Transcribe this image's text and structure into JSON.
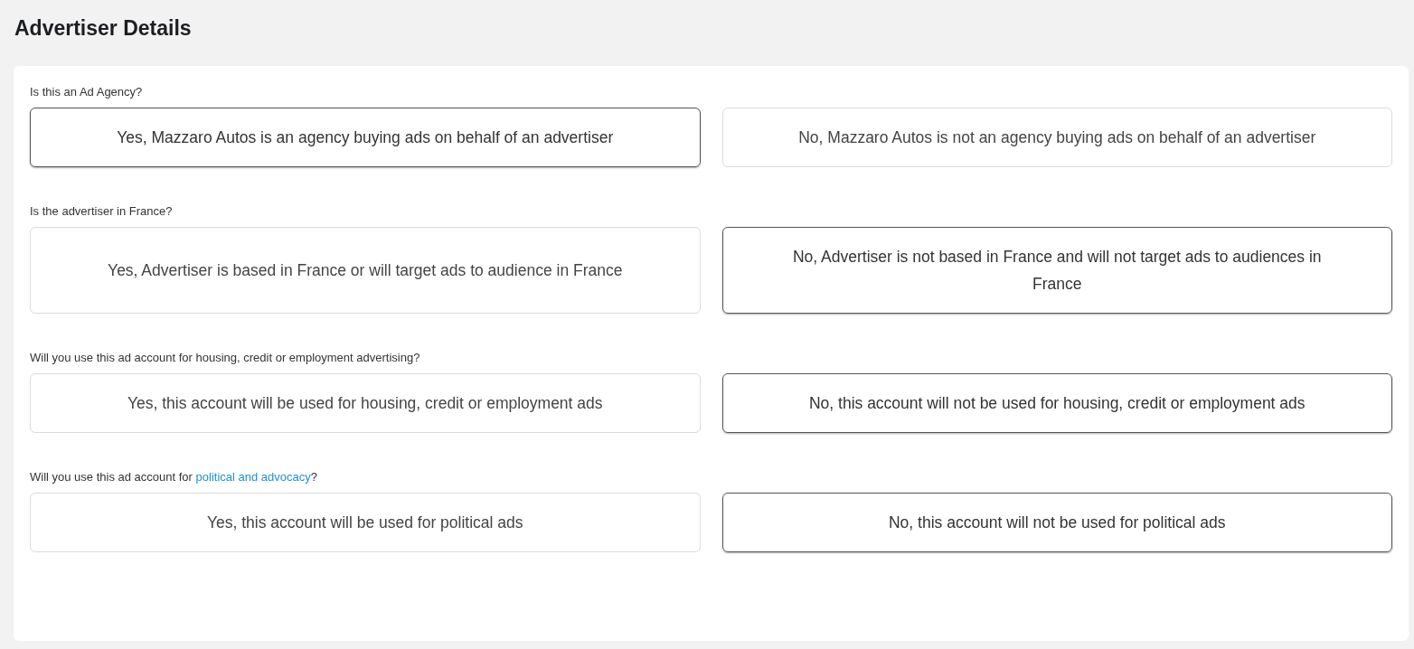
{
  "title": "Advertiser Details",
  "questions": [
    {
      "parts": [
        {
          "kind": "text",
          "text": "Is this an Ad Agency?"
        }
      ],
      "options": [
        {
          "label": "Yes, Mazzaro Autos is an agency buying ads on behalf of an advertiser",
          "selected": true
        },
        {
          "label": "No, Mazzaro Autos is not an agency buying ads on behalf of an advertiser",
          "selected": false
        }
      ]
    },
    {
      "parts": [
        {
          "kind": "text",
          "text": "Is the advertiser in France?"
        }
      ],
      "options": [
        {
          "label": "Yes, Advertiser is based in France or will target ads to audience in France",
          "selected": false
        },
        {
          "label": "No, Advertiser is not based in France and will not target ads to audiences in France",
          "selected": true
        }
      ]
    },
    {
      "parts": [
        {
          "kind": "text",
          "text": "Will you use this ad account for housing, credit or employment advertising?"
        }
      ],
      "options": [
        {
          "label": "Yes, this account will be used for housing, credit or employment ads",
          "selected": false
        },
        {
          "label": "No, this account will not be used for housing, credit or employment ads",
          "selected": true
        }
      ]
    },
    {
      "parts": [
        {
          "kind": "text",
          "text": "Will you use this ad account for "
        },
        {
          "kind": "link",
          "text": "political and advocacy"
        },
        {
          "kind": "text",
          "text": "?"
        }
      ],
      "options": [
        {
          "label": "Yes, this account will be used for political ads",
          "selected": false
        },
        {
          "label": "No, this account will not be used for political ads",
          "selected": true
        }
      ]
    }
  ]
}
